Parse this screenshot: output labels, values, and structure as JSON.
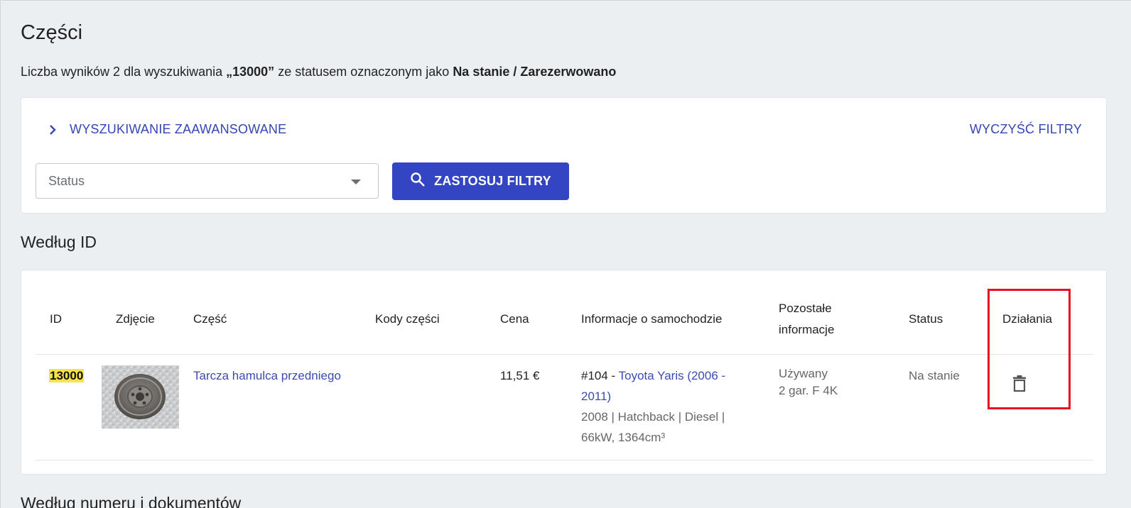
{
  "page": {
    "title": "Części",
    "summary_prefix": "Liczba wyników 2 dla wyszukiwania ",
    "summary_query": "„13000”",
    "summary_middle": " ze statusem oznaczonym jako ",
    "summary_status": "Na stanie / Zarezerwowano"
  },
  "filters": {
    "advanced_search_label": "WYSZUKIWANIE ZAAWANSOWANE",
    "clear_filters_label": "WYCZYŚĆ FILTRY",
    "status_placeholder": "Status",
    "apply_label": "ZASTOSUJ FILTRY"
  },
  "section": {
    "heading": "Według ID",
    "next_heading": "Według numeru i dokumentów"
  },
  "table": {
    "headers": {
      "id": "ID",
      "photo": "Zdjęcie",
      "part": "Część",
      "part_codes": "Kody części",
      "price": "Cena",
      "car_info": "Informacje o samochodzie",
      "other_info_1": "Pozostałe",
      "other_info_2": "informacje",
      "status": "Status",
      "actions": "Działania"
    },
    "rows": [
      {
        "id": "13000",
        "part": "Tarcza hamulca przedniego",
        "part_codes": "",
        "price": "11,51 €",
        "car_prefix": "#104 - ",
        "car_link_1": "Toyota Yaris (2006 -",
        "car_link_2": "2011)",
        "car_details_1": "2008 | Hatchback | Diesel |",
        "car_details_2": "66kW, 1364cm³",
        "other_1": "Używany",
        "other_2": "2 gar. F 4K",
        "status": "Na stanie"
      }
    ]
  },
  "colors": {
    "accent": "#3345c2",
    "link": "#3a4bb3",
    "highlight": "#f6e34a",
    "annotation": "#e8101e"
  },
  "icons": {
    "advanced_toggle": "chevron-right-icon",
    "apply": "search-icon",
    "select": "caret-down-icon",
    "delete": "trash-icon"
  }
}
